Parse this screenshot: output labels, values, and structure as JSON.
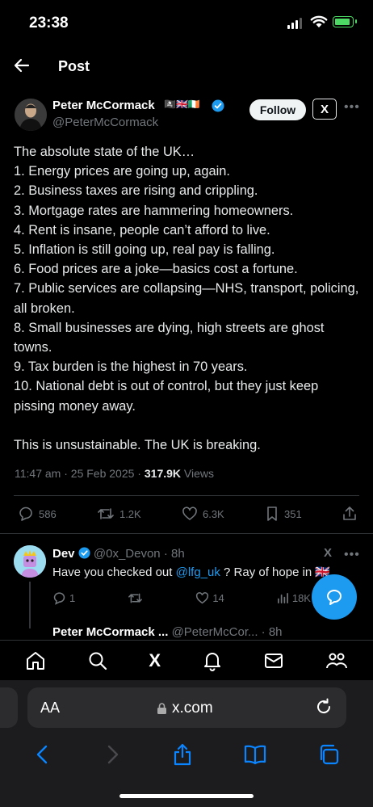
{
  "status_bar": {
    "time": "23:38"
  },
  "header": {
    "title": "Post"
  },
  "author": {
    "name": "Peter McCormack",
    "emojis": "🏴‍☠️🇬🇧🇮🇪",
    "handle": "@PeterMcCormack",
    "follow_label": "Follow",
    "grok_label": "X"
  },
  "tweet": {
    "text": "The absolute state of the UK…\n1. Energy prices are going up, again.\n2. Business taxes are rising and crippling.\n3. Mortgage rates are hammering homeowners.\n4. Rent is insane, people can’t afford to live.\n5. Inflation is still going up, real pay is falling.\n6. Food prices are a joke—basics cost a fortune.\n7. Public services are collapsing—NHS, transport, policing, all broken.\n8. Small businesses are dying, high streets are ghost towns.\n9. Tax burden is the highest in 70 years.\n10. National debt is out of control, but they just keep pissing money away.\n\nThis is unsustainable. The UK is breaking.",
    "time": "11:47 am",
    "date": "25 Feb 2025",
    "views_count": "317.9K",
    "views_label": "Views"
  },
  "actions": {
    "replies": "586",
    "reposts": "1.2K",
    "likes": "6.3K",
    "bookmarks": "351"
  },
  "reply": {
    "name": "Dev",
    "handle": "@0x_Devon",
    "age": "8h",
    "text_before": "Have you checked out ",
    "link": "@lfg_uk",
    "text_after": " ? Ray of hope in 🇬🇧",
    "replies": "1",
    "likes": "14",
    "views": "18K"
  },
  "next_reply": {
    "name": "Peter McCormack ...",
    "handle": "@PeterMcCor...",
    "age": "8h"
  },
  "safari": {
    "aa_label": "AA",
    "url": "x.com"
  },
  "colors": {
    "accent": "#1d9bf0",
    "background": "#000000",
    "secondary_text": "#71767b"
  }
}
